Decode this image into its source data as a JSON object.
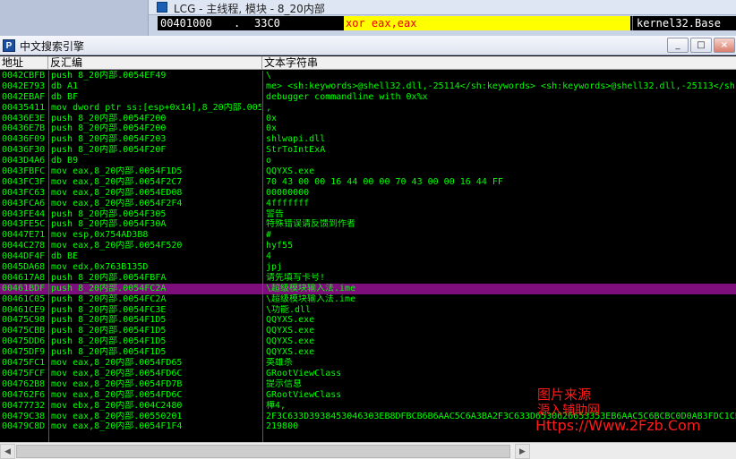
{
  "background_window": {
    "title": "LCG - 主线程, 模块 - 8_20内部",
    "cpu_row": {
      "address": "00401000",
      "marker": ".",
      "hex": "33C0",
      "instruction": "xor eax,eax",
      "comment": "kernel32.Base"
    }
  },
  "window": {
    "title": "中文搜索引擎",
    "icon_letter": "P",
    "buttons": {
      "minimize": "_",
      "maximize": "□",
      "close": "×"
    }
  },
  "columns": {
    "address": "地址",
    "disassembly": "反汇编",
    "text": "文本字符串"
  },
  "selected_index": 20,
  "rows": [
    [
      "0042CBFB",
      "push 8_20内部.0054EF49",
      "\\"
    ],
    [
      "0042E793",
      "db A1",
      "me> <sh:keywords>@shell32.dll,-25114</sh:keywords> <sh:keywords>@shell32.dll,-25113</sh:k"
    ],
    [
      "0042EBAF",
      "db BF",
      "debugger commandline with 0x%x"
    ],
    [
      "00435411",
      "mov dword ptr ss:[esp+0x14],8_20内部.005",
      ","
    ],
    [
      "00436E3E",
      "push 8_20内部.0054F200",
      "0x"
    ],
    [
      "00436E7B",
      "push 8_20内部.0054F200",
      "0x"
    ],
    [
      "00436F09",
      "push 8_20内部.0054F203",
      "shlwapi.dll"
    ],
    [
      "00436F30",
      "push 8_20内部.0054F20F",
      "StrToIntExA"
    ],
    [
      "0043D4A6",
      "db B9",
      "o"
    ],
    [
      "0043FBFC",
      "mov eax,8_20内部.0054F1D5",
      "QQYXS.exe"
    ],
    [
      "0043FC3F",
      "mov eax,8_20内部.0054F2C7",
      "70 43 00 00 16 44 00 00 70 43 00 00 16 44 FF"
    ],
    [
      "0043FC63",
      "mov eax,8_20内部.0054ED08",
      "00000000"
    ],
    [
      "0043FCA6",
      "mov eax,8_20内部.0054F2F4",
      "4fffffff"
    ],
    [
      "0043FE44",
      "push 8_20内部.0054F305",
      "警告"
    ],
    [
      "0043FE5C",
      "push 8_20内部.0054F30A",
      "特殊错误请反馈到作者"
    ],
    [
      "00447E71",
      "mov esp,0x754AD3B8",
      "#"
    ],
    [
      "0044C278",
      "mov eax,8_20内部.0054F520",
      "hyf55"
    ],
    [
      "0044DF4F",
      "db BE",
      "4"
    ],
    [
      "0045DA68",
      "mov edx,0x763B135D",
      "jpj"
    ],
    [
      "004617A8",
      "push 8_20内部.0054FBFA",
      "请先填写卡号!"
    ],
    [
      "00461BDF",
      "push 8_20内部.0054FC2A",
      "\\超级模块输入法.ime"
    ],
    [
      "00461C05",
      "push 8_20内部.0054FC2A",
      "\\超级模块输入法.ime"
    ],
    [
      "00461CE9",
      "push 8_20内部.0054FC3E",
      "\\功能.dll"
    ],
    [
      "00475C98",
      "push 8_20内部.0054F1D5",
      "QQYXS.exe"
    ],
    [
      "00475CBB",
      "push 8_20内部.0054F1D5",
      "QQYXS.exe"
    ],
    [
      "00475DD6",
      "push 8_20内部.0054F1D5",
      "QQYXS.exe"
    ],
    [
      "00475DF9",
      "push 8_20内部.0054F1D5",
      "QQYXS.exe"
    ],
    [
      "00475FC1",
      "mov eax,8_20内部.0054FD65",
      "英雄杀"
    ],
    [
      "00475FCF",
      "mov eax,8_20内部.0054FD6C",
      "GRootViewClass"
    ],
    [
      "004762B8",
      "mov eax,8_20内部.0054FD7B",
      "提示信息"
    ],
    [
      "004762F6",
      "mov eax,8_20内部.0054FD6C",
      "GRootViewClass"
    ],
    [
      "00477732",
      "mov ebx,8_20内部.004C2480",
      "樺4,"
    ],
    [
      "00479C38",
      "mov eax,8_20内部.00550201",
      "2F3C633D3938453046303EB8DFBCB6B6AAC5C6A3BA2F3C633D6530626653353EB6AAC5C6BCBC0D0AB3FDC1CE"
    ],
    [
      "00479C8D",
      "mov eax,8_20内部.0054F1F4",
      "219800"
    ]
  ],
  "watermark": {
    "line1": "图片来源",
    "line2": "源入辅助网",
    "line3": "Https://Www.2Fzb.Com"
  }
}
